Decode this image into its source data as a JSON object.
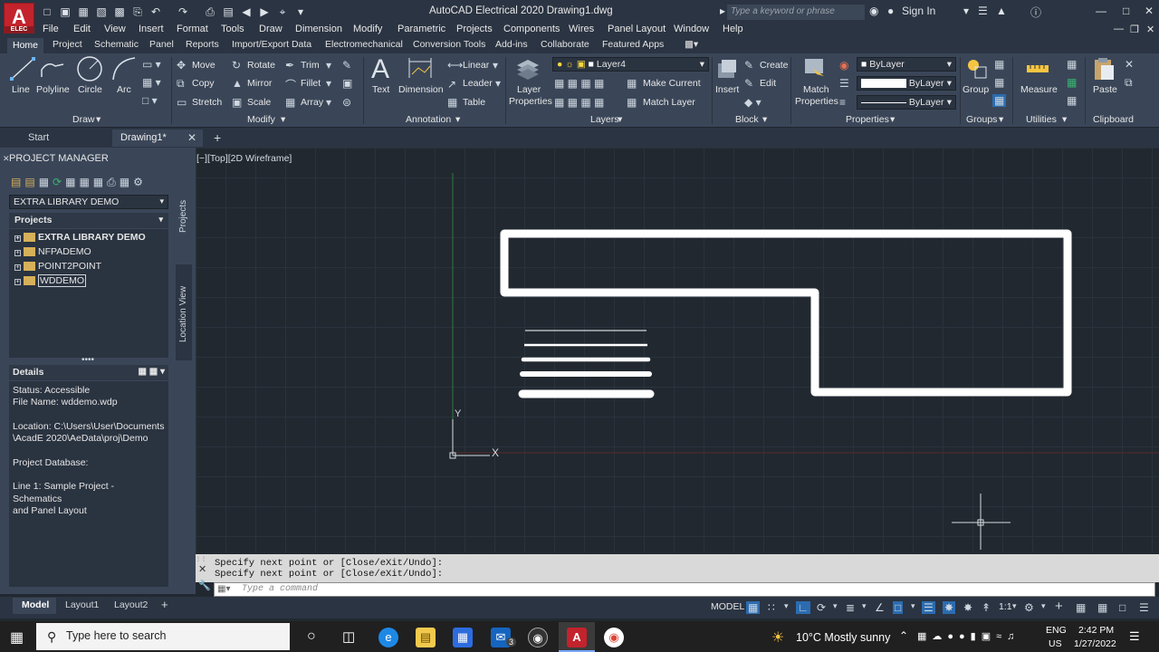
{
  "title_bar": {
    "app_logo": "A",
    "app_logo_sub": "ELEC",
    "title": "AutoCAD Electrical 2020   Drawing1.dwg",
    "search_placeholder": "Type a keyword or phrase",
    "sign_in": "Sign In"
  },
  "menu": [
    "File",
    "Edit",
    "View",
    "Insert",
    "Format",
    "Tools",
    "Draw",
    "Dimension",
    "Modify",
    "Parametric",
    "Projects",
    "Components",
    "Wires",
    "Panel Layout",
    "Window",
    "Help"
  ],
  "ribbon_tabs": [
    "Home",
    "Project",
    "Schematic",
    "Panel",
    "Reports",
    "Import/Export Data",
    "Electromechanical",
    "Conversion Tools",
    "Add-ins",
    "Collaborate",
    "Featured Apps"
  ],
  "ribbon": {
    "draw": {
      "title": "Draw",
      "line": "Line",
      "polyline": "Polyline",
      "circle": "Circle",
      "arc": "Arc"
    },
    "modify": {
      "title": "Modify",
      "move": "Move",
      "rotate": "Rotate",
      "trim": "Trim",
      "copy": "Copy",
      "mirror": "Mirror",
      "fillet": "Fillet",
      "stretch": "Stretch",
      "scale": "Scale",
      "array": "Array"
    },
    "annotation": {
      "title": "Annotation",
      "text": "Text",
      "dimension": "Dimension",
      "linear": "Linear",
      "leader": "Leader",
      "table": "Table"
    },
    "layers": {
      "title": "Layers",
      "layer_properties_1": "Layer",
      "layer_properties_2": "Properties",
      "current_layer": "Layer4",
      "make_current": "Make Current",
      "match_layer": "Match Layer"
    },
    "block": {
      "title": "Block",
      "insert": "Insert",
      "create": "Create",
      "edit": "Edit"
    },
    "properties": {
      "title": "Properties",
      "match_1": "Match",
      "match_2": "Properties",
      "color": "ByLayer",
      "lineweight": "ByLayer",
      "linetype": "ByLayer"
    },
    "groups": {
      "title": "Groups",
      "group": "Group"
    },
    "utilities": {
      "title": "Utilities",
      "measure": "Measure"
    },
    "clipboard": {
      "title": "Clipboard",
      "paste": "Paste"
    }
  },
  "doc_tabs": {
    "start": "Start",
    "drawing": "Drawing1*"
  },
  "project_manager": {
    "title": "PROJECT MANAGER",
    "combo": "EXTRA LIBRARY DEMO",
    "projects_header": "Projects",
    "projects": [
      "EXTRA LIBRARY DEMO",
      "NFPADEMO",
      "POINT2POINT",
      "WDDEMO"
    ],
    "side_tabs": [
      "Projects",
      "Location View"
    ],
    "details_header": "Details",
    "details": [
      "Status: Accessible",
      "File Name: wddemo.wdp",
      "",
      "Location: C:\\Users\\User\\Documents",
      "\\AcadE 2020\\AeData\\proj\\Demo",
      "",
      "Project Database:",
      "",
      "Line 1: Sample Project - Schematics",
      "and Panel Layout"
    ]
  },
  "viewport": {
    "label": "[−][Top][2D Wireframe]",
    "ucs_x": "X",
    "ucs_y": "Y"
  },
  "command": {
    "history": [
      "Specify next point or [Close/eXit/Undo]:",
      "Specify next point or [Close/eXit/Undo]:"
    ],
    "placeholder": "Type a command"
  },
  "layout_tabs": [
    "Model",
    "Layout1",
    "Layout2"
  ],
  "status": {
    "model": "MODEL",
    "scale": "1:1"
  },
  "taskbar": {
    "search_placeholder": "Type here to search",
    "weather": "10°C  Mostly sunny",
    "lang_1": "ENG",
    "lang_2": "US",
    "time": "2:42 PM",
    "date": "1/27/2022",
    "mail_badge": "3"
  }
}
